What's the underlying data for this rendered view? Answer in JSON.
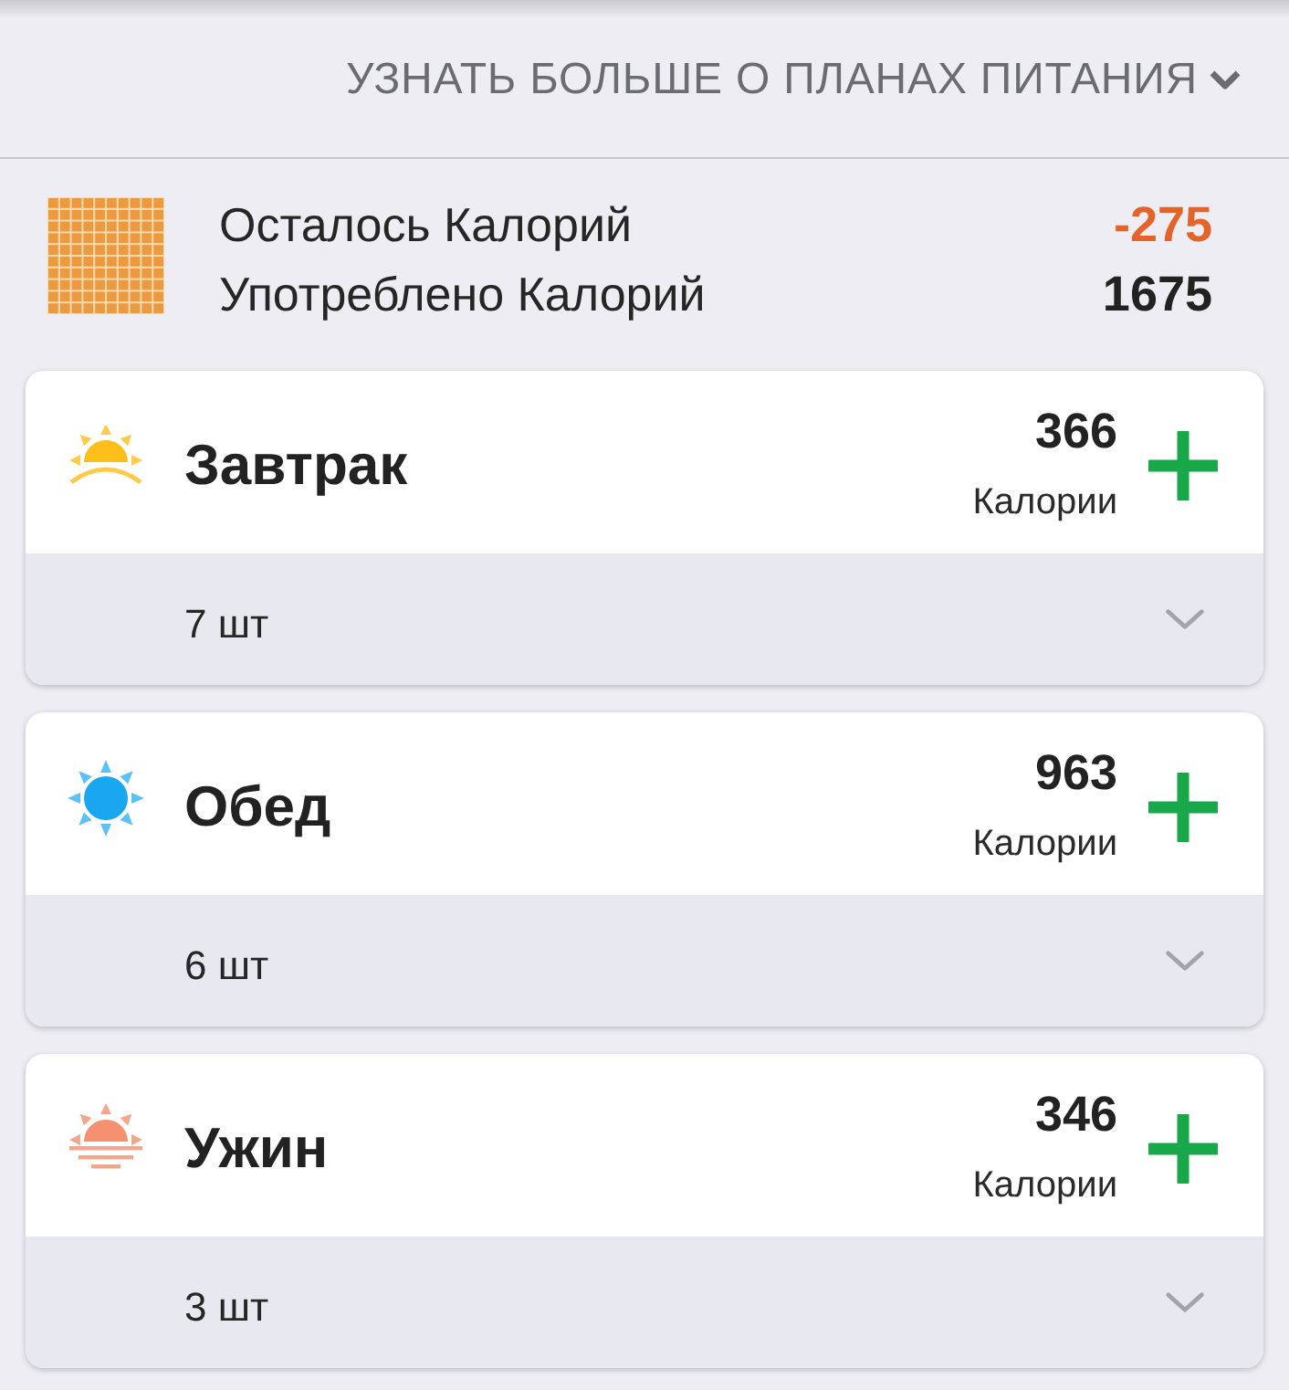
{
  "header": {
    "link": {
      "label": "УЗНАТЬ БОЛЬШЕ О ПЛАНАХ ПИТАНИЯ",
      "expanded": false
    }
  },
  "summary": {
    "rows": [
      {
        "label": "Осталось Калорий",
        "value": "-275",
        "color": "#e4632b"
      },
      {
        "label": "Употреблено Калорий",
        "value": "1675",
        "color": "#222222"
      }
    ]
  },
  "meals": [
    {
      "kind": "breakfast",
      "name": "Завтрак",
      "calories": "366",
      "unit": "Калории",
      "count": "7 шт",
      "expanded": false
    },
    {
      "kind": "lunch",
      "name": "Обед",
      "calories": "963",
      "unit": "Калории",
      "count": "6 шт",
      "expanded": false
    },
    {
      "kind": "dinner",
      "name": "Ужин",
      "calories": "346",
      "unit": "Калории",
      "count": "3 шт",
      "expanded": false
    }
  ]
}
